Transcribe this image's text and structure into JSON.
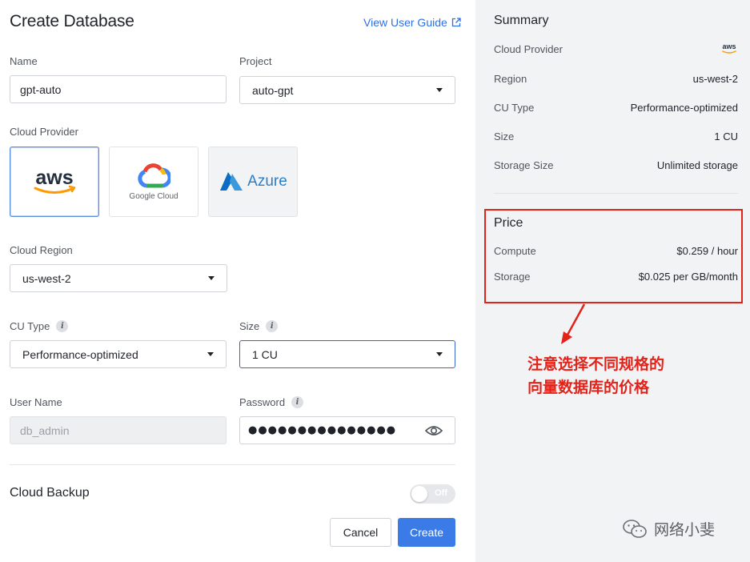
{
  "form": {
    "title": "Create Database",
    "guide_link": "View User Guide",
    "name_label": "Name",
    "name_value": "gpt-auto",
    "project_label": "Project",
    "project_value": "auto-gpt",
    "provider_label": "Cloud Provider",
    "providers": [
      {
        "id": "aws",
        "label": "aws",
        "selected": true
      },
      {
        "id": "gcp",
        "label": "Google Cloud",
        "selected": false
      },
      {
        "id": "azure",
        "label": "Azure",
        "selected": false
      }
    ],
    "region_label": "Cloud Region",
    "region_value": "us-west-2",
    "cu_type_label": "CU Type",
    "cu_type_value": "Performance-optimized",
    "size_label": "Size",
    "size_value": "1 CU",
    "username_label": "User Name",
    "username_placeholder": "db_admin",
    "password_label": "Password",
    "password_value": "●●●●●●●●●●●●●●●",
    "backup_label": "Cloud Backup",
    "backup_toggle": "Off",
    "cancel_label": "Cancel",
    "create_label": "Create"
  },
  "summary": {
    "title": "Summary",
    "rows": [
      {
        "key": "Cloud Provider",
        "value": "aws"
      },
      {
        "key": "Region",
        "value": "us-west-2"
      },
      {
        "key": "CU Type",
        "value": "Performance-optimized"
      },
      {
        "key": "Size",
        "value": "1 CU"
      },
      {
        "key": "Storage Size",
        "value": "Unlimited storage"
      }
    ]
  },
  "price": {
    "title": "Price",
    "rows": [
      {
        "key": "Compute",
        "value": "$0.259 / hour"
      },
      {
        "key": "Storage",
        "value": "$0.025 per GB/month"
      }
    ]
  },
  "annotation": {
    "line1": "注意选择不同规格的",
    "line2": "向量数据库的价格"
  },
  "watermark": "网络小斐",
  "colors": {
    "accent": "#3b7be8",
    "link": "#2d6fe6",
    "annotation": "#e2231a",
    "aws_orange": "#ff9900"
  }
}
